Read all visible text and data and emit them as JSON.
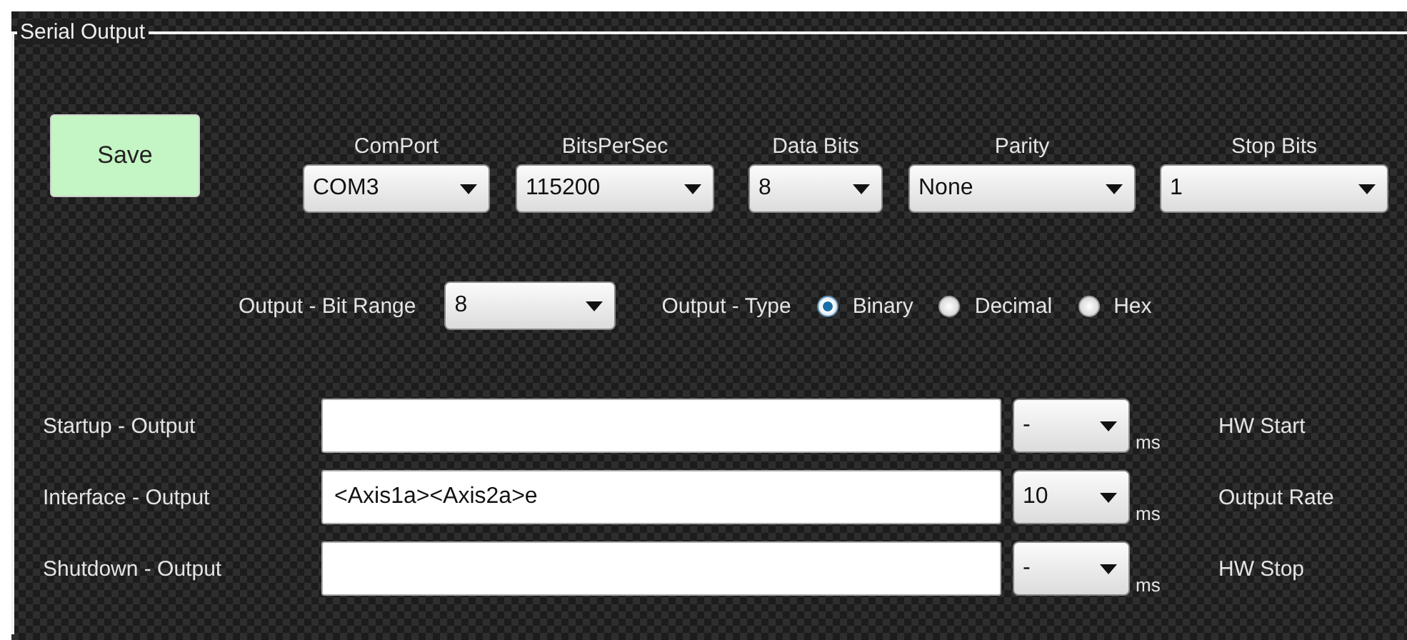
{
  "group": {
    "title": "Serial Output"
  },
  "save_button": "Save",
  "port_settings": [
    {
      "label": "ComPort",
      "value": "COM3"
    },
    {
      "label": "BitsPerSec",
      "value": "115200"
    },
    {
      "label": "Data Bits",
      "value": "8"
    },
    {
      "label": "Parity",
      "value": "None"
    },
    {
      "label": "Stop Bits",
      "value": "1"
    }
  ],
  "bit_range": {
    "label": "Output - Bit Range",
    "value": "8"
  },
  "output_type": {
    "label": "Output - Type",
    "options": [
      {
        "label": "Binary",
        "selected": true
      },
      {
        "label": "Decimal",
        "selected": false
      },
      {
        "label": "Hex",
        "selected": false
      }
    ]
  },
  "outputs": [
    {
      "label": "Startup - Output",
      "interval": "-",
      "unit": "ms",
      "note": "HW Start"
    },
    {
      "label": "Interface - Output",
      "value": "<Axis1a><Axis2a>e",
      "interval": "10",
      "unit": "ms",
      "note": "Output Rate"
    },
    {
      "label": "Shutdown - Output",
      "interval": "-",
      "unit": "ms",
      "note": "HW Stop"
    }
  ]
}
